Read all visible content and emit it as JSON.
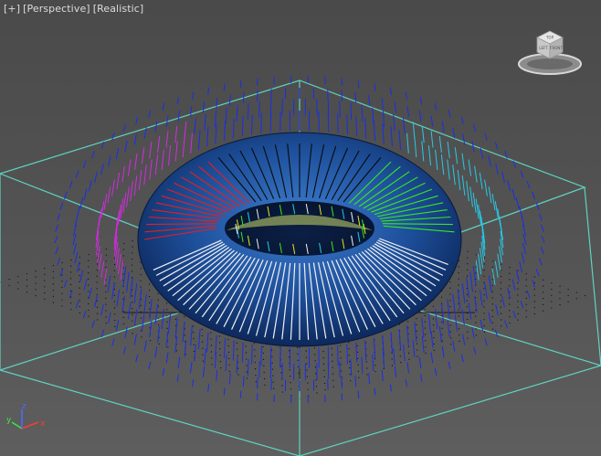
{
  "viewport": {
    "menu": {
      "plus": "[+]",
      "view": "[Perspective]",
      "shading": "[Realistic]"
    },
    "viewcube": {
      "faces": [
        "TOP",
        "FRONT",
        "LEFT"
      ]
    },
    "axis_tripod": {
      "x": "x",
      "y": "y",
      "z": "z"
    }
  },
  "colors": {
    "background": "#545454",
    "grid_box": "#5fd3c2",
    "torus": "#1d4f9a",
    "vector_blue": "#1a2ee8",
    "vector_magenta": "#d42be0",
    "vector_cyan": "#27c9e6",
    "vector_red": "#e81e1e",
    "vector_green": "#37e81e",
    "vector_yellow": "#e8e61e",
    "vector_white": "#f2f2f2",
    "axis_x": "#ff3b30",
    "axis_y": "#3ee63e",
    "axis_z": "#4d6bff"
  }
}
